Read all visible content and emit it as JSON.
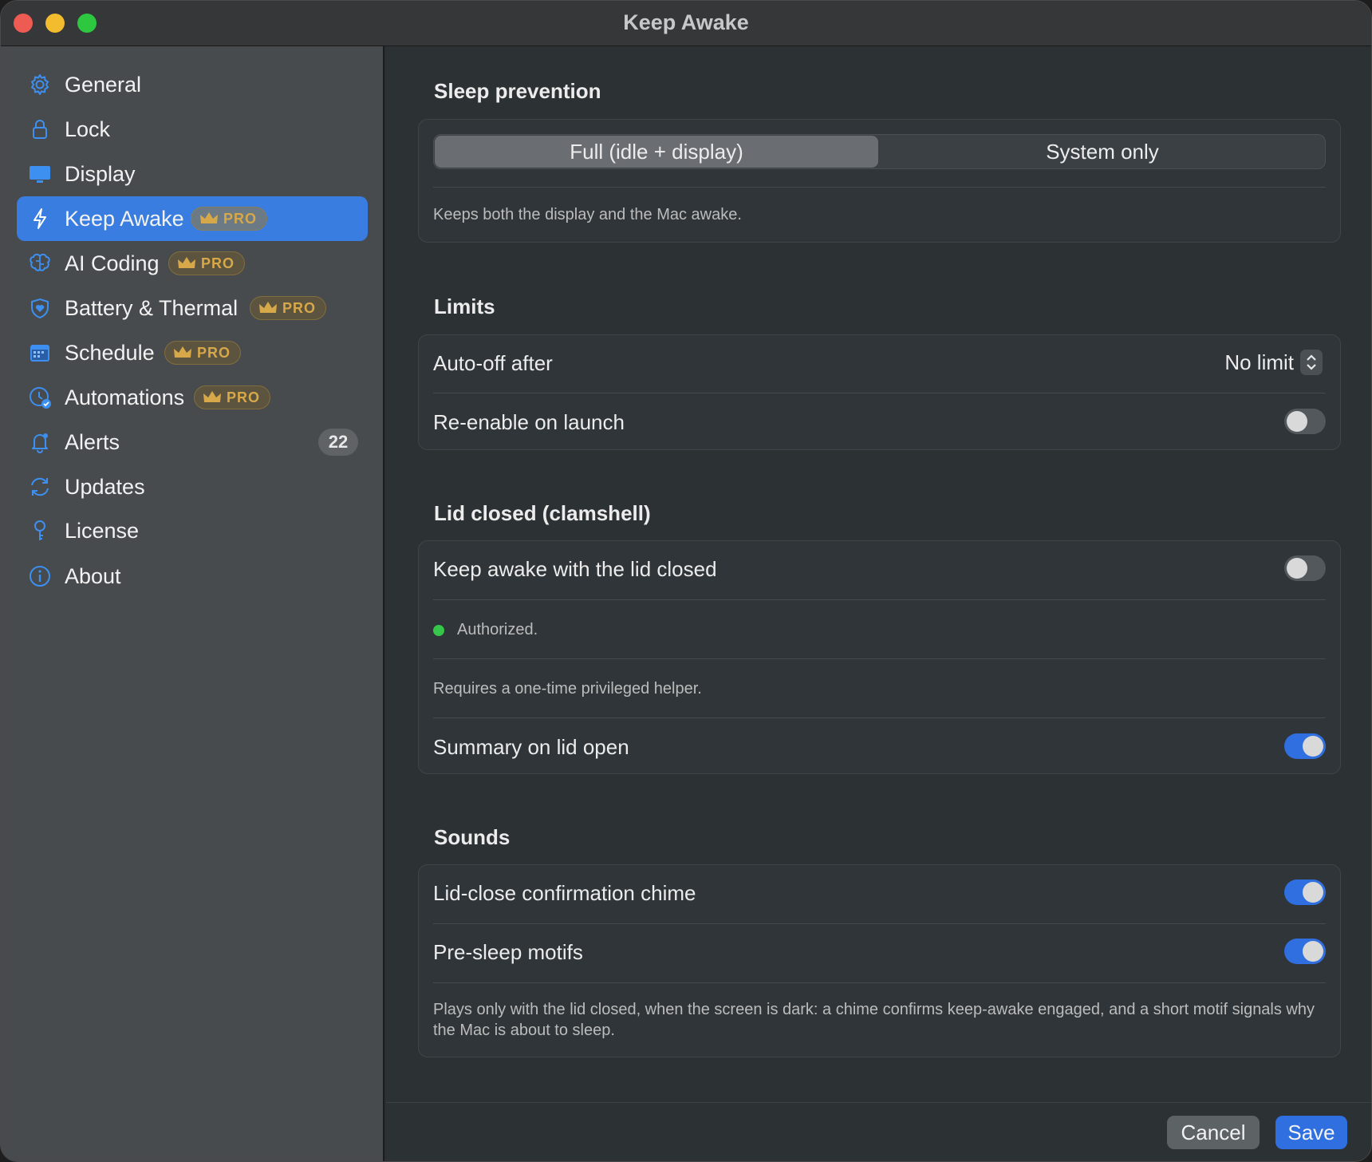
{
  "window": {
    "title": "Keep Awake"
  },
  "sidebar": {
    "items": [
      {
        "label": "General",
        "icon": "gear-icon",
        "pro": false
      },
      {
        "label": "Lock",
        "icon": "lock-icon",
        "pro": false
      },
      {
        "label": "Display",
        "icon": "display-icon",
        "pro": false
      },
      {
        "label": "Keep Awake",
        "icon": "bolt-icon",
        "pro": true,
        "active": true
      },
      {
        "label": "AI Coding",
        "icon": "brain-icon",
        "pro": true
      },
      {
        "label": "Battery & Thermal",
        "icon": "heart-shield-icon",
        "pro": true
      },
      {
        "label": "Schedule",
        "icon": "calendar-icon",
        "pro": true
      },
      {
        "label": "Automations",
        "icon": "clock-check-icon",
        "pro": true
      },
      {
        "label": "Alerts",
        "icon": "bell-icon",
        "pro": false,
        "count": "22"
      },
      {
        "label": "Updates",
        "icon": "refresh-icon",
        "pro": false
      },
      {
        "label": "License",
        "icon": "key-icon",
        "pro": false
      },
      {
        "label": "About",
        "icon": "info-icon",
        "pro": false
      }
    ],
    "pro_label": "PRO"
  },
  "sleep_prevention": {
    "title": "Sleep prevention",
    "options": [
      "Full (idle + display)",
      "System only"
    ],
    "selected": "Full (idle + display)",
    "note": "Keeps both the display and the Mac awake."
  },
  "limits": {
    "title": "Limits",
    "auto_off_label": "Auto-off after",
    "auto_off_value": "No limit",
    "reenable_label": "Re-enable on launch",
    "reenable_on": false
  },
  "lid": {
    "title": "Lid closed (clamshell)",
    "keep_awake_label": "Keep awake with the lid closed",
    "keep_awake_on": false,
    "status": "Authorized.",
    "helper_note": "Requires a one-time privileged helper.",
    "summary_label": "Summary on lid open",
    "summary_on": true
  },
  "sounds": {
    "title": "Sounds",
    "chime_label": "Lid-close confirmation chime",
    "chime_on": true,
    "motifs_label": "Pre-sleep motifs",
    "motifs_on": true,
    "note": "Plays only with the lid closed, when the screen is dark: a chime confirms keep-awake engaged, and a short motif signals why the Mac is about to sleep."
  },
  "footer": {
    "cancel_label": "Cancel",
    "save_label": "Save"
  },
  "colors": {
    "accent": "#2f6fe0",
    "sidebar_active": "#3a7de0",
    "pro_gold": "#d7a84a",
    "status_green": "#35c64a"
  }
}
